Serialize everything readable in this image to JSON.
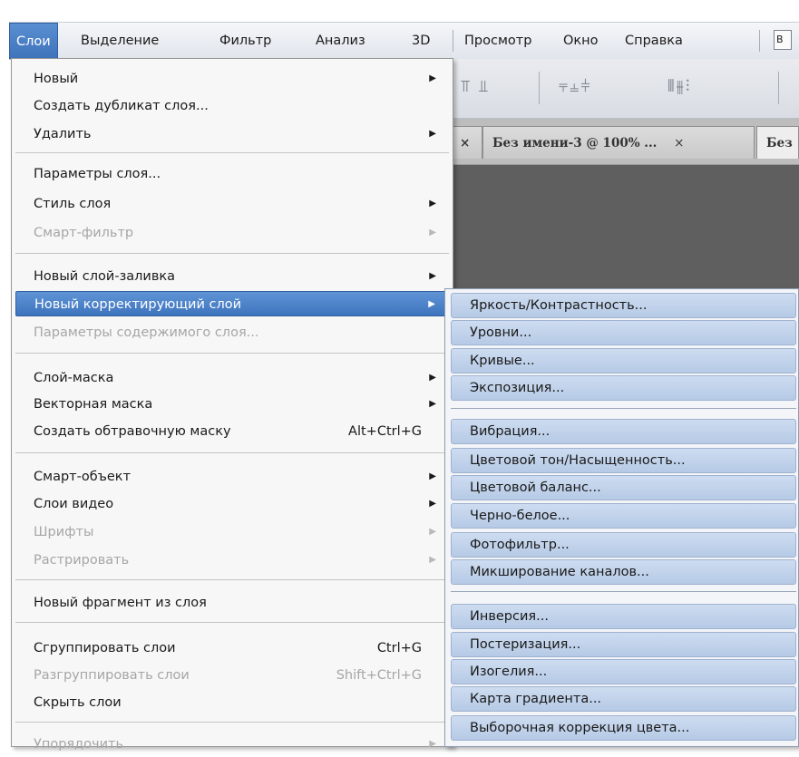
{
  "menubar": {
    "items": [
      {
        "label": "Слои",
        "active": true
      },
      {
        "label": "Выделение"
      },
      {
        "label": "Фильтр"
      },
      {
        "label": "Анализ"
      },
      {
        "label": "3D"
      },
      {
        "label": "Просмотр"
      },
      {
        "label": "Окно"
      },
      {
        "label": "Справка"
      }
    ],
    "extra_box_label": "В"
  },
  "toolbar": {
    "align_glyphs_1": "⫪ ⫫",
    "align_glyphs_2": "⫧⫨⫩",
    "distribute_glyphs": "⫴⫵⫶"
  },
  "tabs": [
    {
      "label": "Без имени-3 @ 100% ...",
      "close": "×"
    },
    {
      "label": "Без"
    }
  ],
  "tab_prefix_close": "×",
  "layer_menu": {
    "items": [
      {
        "label": "Новый",
        "submenu": true
      },
      {
        "label": "Создать дубликат слоя..."
      },
      {
        "label": "Удалить",
        "submenu": true
      },
      {
        "label": "Параметры слоя..."
      },
      {
        "label": "Стиль слоя",
        "submenu": true
      },
      {
        "label": "Смарт-фильтр",
        "submenu": true,
        "disabled": true
      },
      {
        "label": "Новый слой-заливка",
        "submenu": true
      },
      {
        "label": "Новый корректирующий слой",
        "submenu": true,
        "highlighted": true
      },
      {
        "label": "Параметры содержимого слоя...",
        "disabled": true
      },
      {
        "label": "Слой-маска",
        "submenu": true
      },
      {
        "label": "Векторная маска",
        "submenu": true
      },
      {
        "label": "Создать обтравочную маску",
        "shortcut": "Alt+Ctrl+G"
      },
      {
        "label": "Смарт-объект",
        "submenu": true
      },
      {
        "label": "Слои видео",
        "submenu": true
      },
      {
        "label": "Шрифты",
        "submenu": true,
        "disabled": true
      },
      {
        "label": "Растрировать",
        "submenu": true,
        "disabled": true
      },
      {
        "label": "Новый фрагмент из слоя"
      },
      {
        "label": "Сгруппировать слои",
        "shortcut": "Ctrl+G"
      },
      {
        "label": "Разгруппировать слои",
        "shortcut": "Shift+Ctrl+G",
        "disabled": true
      },
      {
        "label": "Скрыть слои"
      },
      {
        "label": "Упорядочить",
        "submenu": true,
        "disabled": true
      }
    ]
  },
  "adjustment_submenu": {
    "items": [
      {
        "label": "Яркость/Контрастность..."
      },
      {
        "label": "Уровни..."
      },
      {
        "label": "Кривые..."
      },
      {
        "label": "Экспозиция..."
      },
      {
        "label": "Вибрация..."
      },
      {
        "label": "Цветовой тон/Насыщенность..."
      },
      {
        "label": "Цветовой баланс..."
      },
      {
        "label": "Черно-белое..."
      },
      {
        "label": "Фотофильтр..."
      },
      {
        "label": "Микширование каналов..."
      },
      {
        "label": "Инверсия..."
      },
      {
        "label": "Постеризация..."
      },
      {
        "label": "Изогелия..."
      },
      {
        "label": "Карта градиента..."
      },
      {
        "label": "Выборочная коррекция цвета..."
      }
    ]
  },
  "icons": {
    "submenu_arrow": "triangle-right-icon"
  },
  "colors": {
    "highlight": "#4a80c8",
    "submenu_item": "#c3d4ec"
  }
}
